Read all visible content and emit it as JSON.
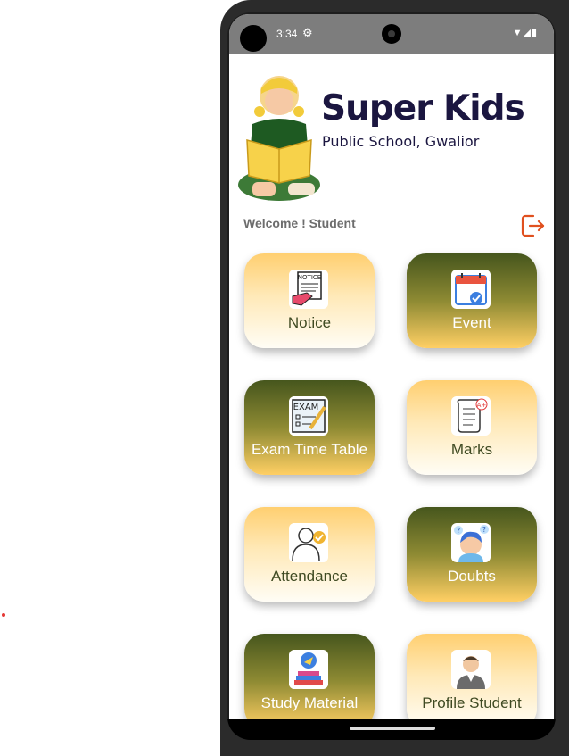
{
  "status_bar": {
    "time": "3:34"
  },
  "brand": {
    "title": "Super Kids",
    "subtitle": "Public School, Gwalior"
  },
  "welcome_text": "Welcome ! Student",
  "tiles": [
    {
      "label": "Notice",
      "icon": "notice-icon"
    },
    {
      "label": "Event",
      "icon": "calendar-icon"
    },
    {
      "label": "Exam Time Table",
      "icon": "exam-icon"
    },
    {
      "label": "Marks",
      "icon": "marks-icon"
    },
    {
      "label": "Attendance",
      "icon": "attendance-icon"
    },
    {
      "label": "Doubts",
      "icon": "doubts-icon"
    },
    {
      "label": "Study Material",
      "icon": "study-material-icon"
    },
    {
      "label": "Profile Student",
      "icon": "profile-icon"
    }
  ],
  "colors": {
    "accent": "#ffcf64",
    "dark_green": "#46561d",
    "logout": "#e0501f",
    "brand_text": "#1b1640"
  }
}
